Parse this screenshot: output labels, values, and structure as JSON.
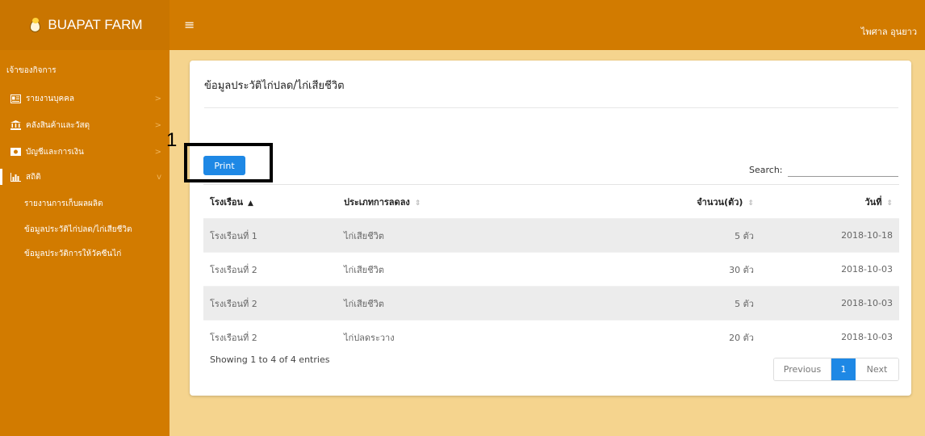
{
  "header": {
    "brand": "BUAPAT FARM",
    "menu_icon": "hamburger-icon",
    "user_name": "ไพศาล อุนยาว"
  },
  "sidebar": {
    "section_title": "เจ้าของกิจการ",
    "items": [
      {
        "label": "รายงานบุคคล",
        "icon": "id-card-icon"
      },
      {
        "label": "คลังสินค้าและวัสดุ",
        "icon": "bank-icon"
      },
      {
        "label": "บัญชีและการเงิน",
        "icon": "money-icon"
      },
      {
        "label": "สถิติ",
        "icon": "bar-chart-icon"
      }
    ],
    "sub_items": [
      {
        "label": "รายงานการเก็บผลผลิต"
      },
      {
        "label": "ข้อมูลประวัติไก่ปลด/ไก่เสียชีวิต"
      },
      {
        "label": "ข้อมูลประวัติการให้วัคซีนไก่"
      }
    ]
  },
  "main": {
    "title": "ข้อมูลประวัติไก่ปลด/ไก่เสียชีวิต",
    "annotation_number": "1",
    "print_label": "Print",
    "search_label": "Search:",
    "search_value": "",
    "columns": [
      "โรงเรือน",
      "ประเภทการลดลง",
      "จำนวน(ตัว)",
      "วันที่"
    ],
    "rows": [
      [
        "โรงเรือนที่ 1",
        "ไก่เสียชีวิต",
        "5 ตัว",
        "2018-10-18"
      ],
      [
        "โรงเรือนที่ 2",
        "ไก่เสียชีวิต",
        "30 ตัว",
        "2018-10-03"
      ],
      [
        "โรงเรือนที่ 2",
        "ไก่เสียชีวิต",
        "5 ตัว",
        "2018-10-03"
      ],
      [
        "โรงเรือนที่ 2",
        "ไก่ปลดระวาง",
        "20 ตัว",
        "2018-10-03"
      ]
    ],
    "info": "Showing 1 to 4 of 4 entries",
    "pagination": {
      "previous": "Previous",
      "current": "1",
      "next": "Next"
    }
  },
  "colors": {
    "topbar": "#d27b00",
    "sidebar": "#d27b00",
    "content_bg": "#f5d48e",
    "primary": "#1e88e5"
  }
}
